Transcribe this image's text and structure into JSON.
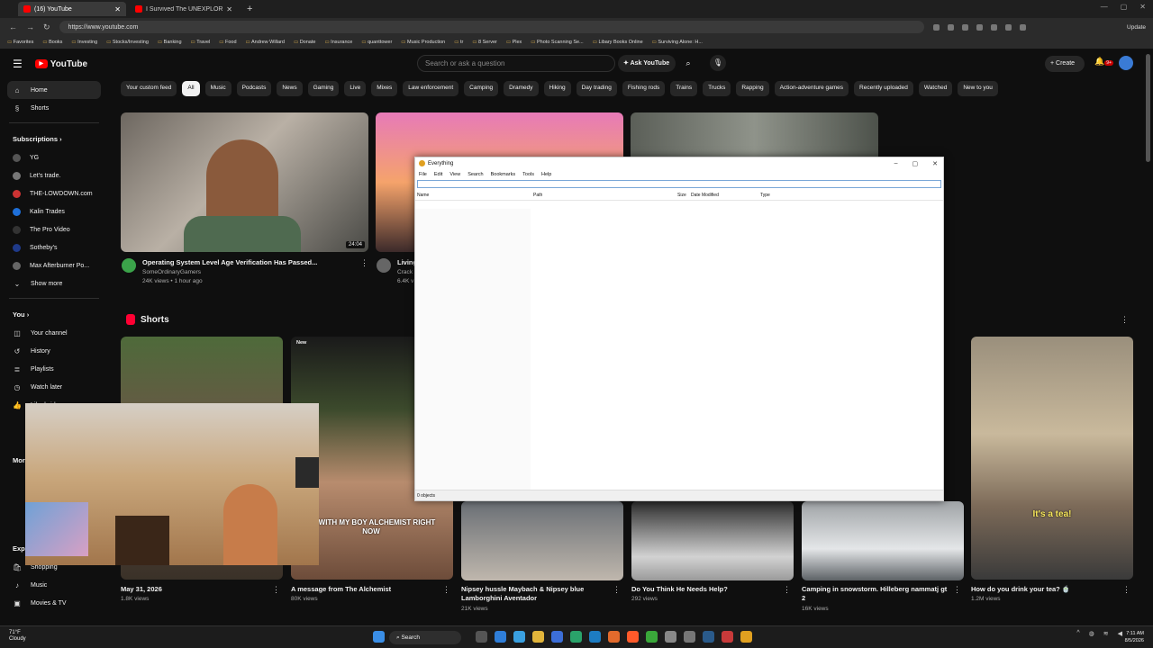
{
  "browser": {
    "tabs": [
      {
        "title": "(16) YouTube"
      },
      {
        "title": "I Survived The UNEXPLORED Wa..."
      }
    ],
    "url": "https://www.youtube.com",
    "update_label": "Update",
    "bookmarks": [
      "Favorites",
      "Books",
      "Investing",
      "Stocks/Investing",
      "Banking",
      "Travel",
      "Food",
      "Andrew Willard",
      "Donate",
      "Insurance",
      "quanttower",
      "Music Production",
      "tr",
      "8 Server",
      "Plex",
      "Photo Scanning Se...",
      "Libary Books Online",
      "Surviving Alone: H..."
    ]
  },
  "youtube": {
    "logo": "YouTube",
    "search_placeholder": "Search or ask a question",
    "ask_label": "Ask YouTube",
    "create_label": "Create",
    "notif_badge": "9+",
    "sidebar": {
      "main": [
        {
          "label": "Home",
          "icon": "home-icon"
        },
        {
          "label": "Shorts",
          "icon": "shorts-icon"
        }
      ],
      "subs_header": "Subscriptions",
      "subs": [
        "YG",
        "Let's trade.",
        "THE-LOWDOWN.com",
        "Kalin Trades",
        "The Pro Video",
        "Sotheby's",
        "Max Afterburner Po..."
      ],
      "show_more": "Show more",
      "you_header": "You",
      "you": [
        {
          "label": "Your channel",
          "icon": "user-icon"
        },
        {
          "label": "History",
          "icon": "history-icon"
        },
        {
          "label": "Playlists",
          "icon": "playlist-icon"
        },
        {
          "label": "Watch later",
          "icon": "clock-icon"
        },
        {
          "label": "Liked videos",
          "icon": "like-icon"
        }
      ],
      "more_header": "Mor",
      "explore_header": "Expl",
      "explore": [
        {
          "label": "Shopping",
          "icon": "bag-icon"
        },
        {
          "label": "Music",
          "icon": "music-icon"
        },
        {
          "label": "Movies & TV",
          "icon": "film-icon"
        }
      ]
    },
    "chips": [
      "Your custom feed",
      "All",
      "Music",
      "Podcasts",
      "News",
      "Gaming",
      "Live",
      "Mixes",
      "Law enforcement",
      "Camping",
      "Dramedy",
      "Hiking",
      "Day trading",
      "Fishing rods",
      "Trains",
      "Trucks",
      "Rapping",
      "Action-adventure games",
      "Recently uploaded",
      "Watched",
      "New to you"
    ],
    "videos": [
      {
        "title": "Operating System Level Age Verification Has Passed...",
        "channel": "SomeOrdinaryGamers",
        "meta": "24K views • 1 hour ago",
        "duration": "24:04"
      },
      {
        "title": "Living",
        "channel": "Crack",
        "meta": "6.4K v"
      }
    ],
    "shorts_header": "Shorts",
    "new_badge": "New",
    "shorts": [
      {
        "title": "May 31, 2026",
        "meta": "1.8K views"
      },
      {
        "title": "A message from The Alchemist",
        "meta": "80K views",
        "caption": "I'M WITH MY BOY ALCHEMIST RIGHT NOW"
      },
      {
        "title": "Nipsey hussle Maybach & Nipsey blue Lamborghini Aventador",
        "meta": "21K views"
      },
      {
        "title": "Do You Think He Needs Help?",
        "meta": "292 views"
      },
      {
        "title": "Camping in snowstorm. Hilleberg nammatj gt 2",
        "meta": "16K views"
      },
      {
        "title": "How do you drink your tea? 🍵",
        "meta": "1.2M views",
        "caption": "It's a tea!"
      }
    ]
  },
  "everything_app": {
    "title": "Everything",
    "menu": [
      "File",
      "Edit",
      "View",
      "Search",
      "Bookmarks",
      "Tools",
      "Help"
    ],
    "columns": [
      "Name",
      "Path",
      "Size",
      "Date Modified",
      "Type"
    ],
    "status": "0 objects"
  },
  "taskbar": {
    "weather_temp": "71°F",
    "weather_desc": "Cloudy",
    "search_label": "Search",
    "time": "7:11 AM",
    "date": "8/5/2026"
  },
  "colors": {
    "brand": "#ff0000",
    "background": "#0f0f0f"
  }
}
